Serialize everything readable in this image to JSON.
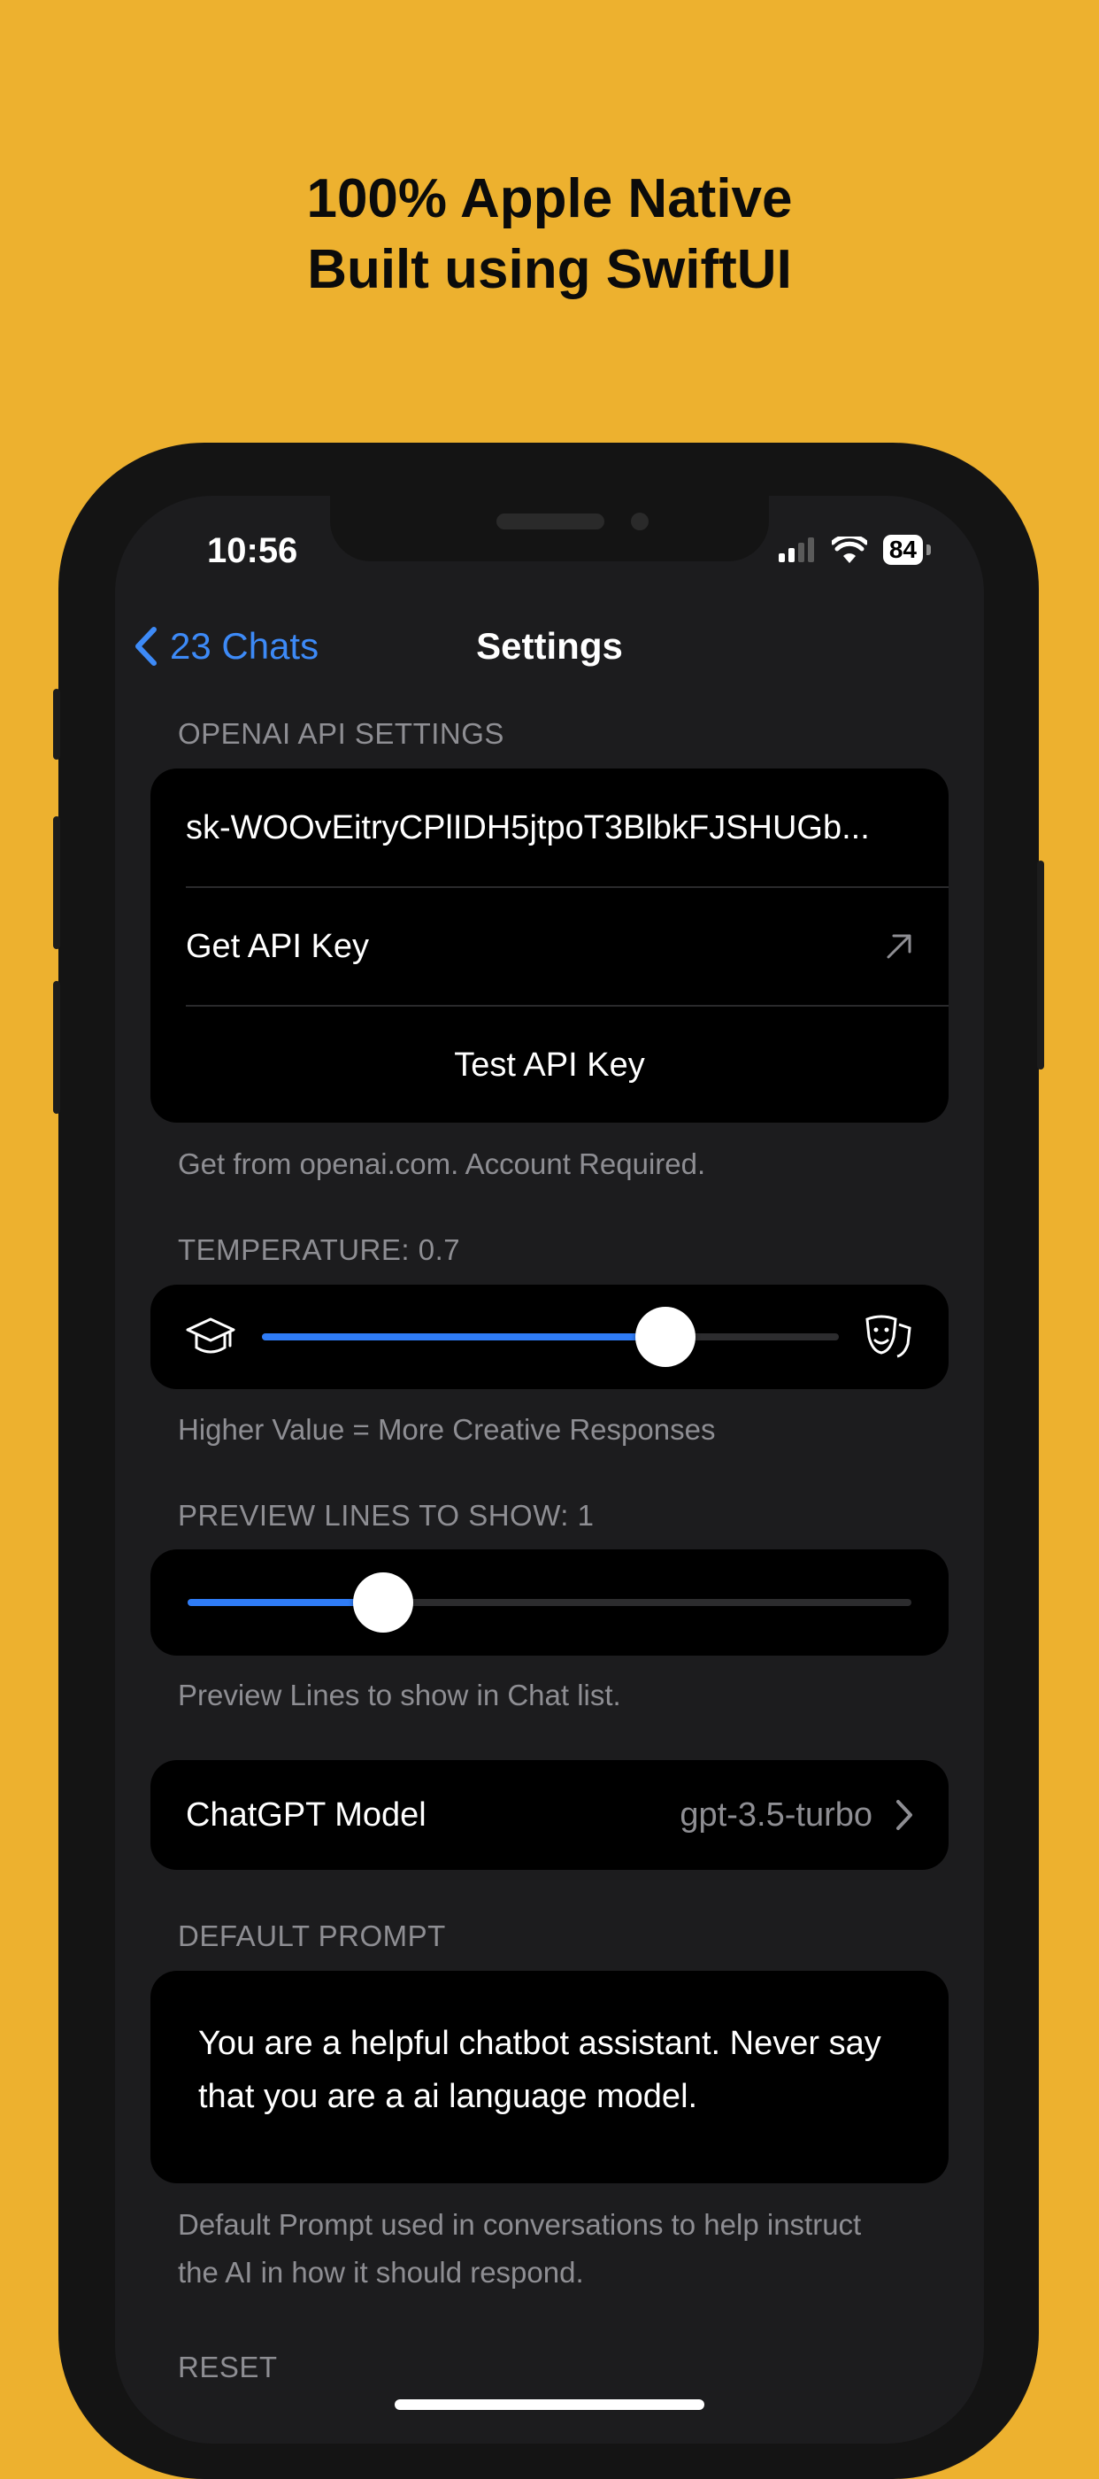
{
  "headline": {
    "line1": "100% Apple Native",
    "line2": "Built using SwiftUI"
  },
  "status_bar": {
    "time": "10:56",
    "battery": "84"
  },
  "nav": {
    "back_label": "23 Chats",
    "title": "Settings"
  },
  "api_settings": {
    "section_label": "OPENAI API SETTINGS",
    "api_key_value": "sk-WOOvEitryCPlIDH5jtpoT3BlbkFJSHUGb...",
    "get_key_label": "Get API Key",
    "test_key_label": "Test API Key",
    "footer": "Get from openai.com. Account Required."
  },
  "temperature": {
    "section_label": "TEMPERATURE: 0.7",
    "value": 0.7,
    "footer": "Higher Value = More Creative Responses"
  },
  "preview_lines": {
    "section_label": "PREVIEW LINES TO SHOW: 1",
    "fill_fraction": 0.27,
    "footer": "Preview Lines to show in Chat list."
  },
  "model": {
    "label": "ChatGPT Model",
    "value": "gpt-3.5-turbo"
  },
  "default_prompt": {
    "section_label": "DEFAULT PROMPT",
    "text": "You are a helpful chatbot assistant. Never say that you are a ai language model.",
    "footer": "Default Prompt used in conversations to help instruct the AI in how it should respond."
  },
  "reset": {
    "section_label": "RESET"
  },
  "colors": {
    "background": "#EDB12F",
    "accent": "#2F7CF6",
    "link": "#3D8AF7"
  }
}
